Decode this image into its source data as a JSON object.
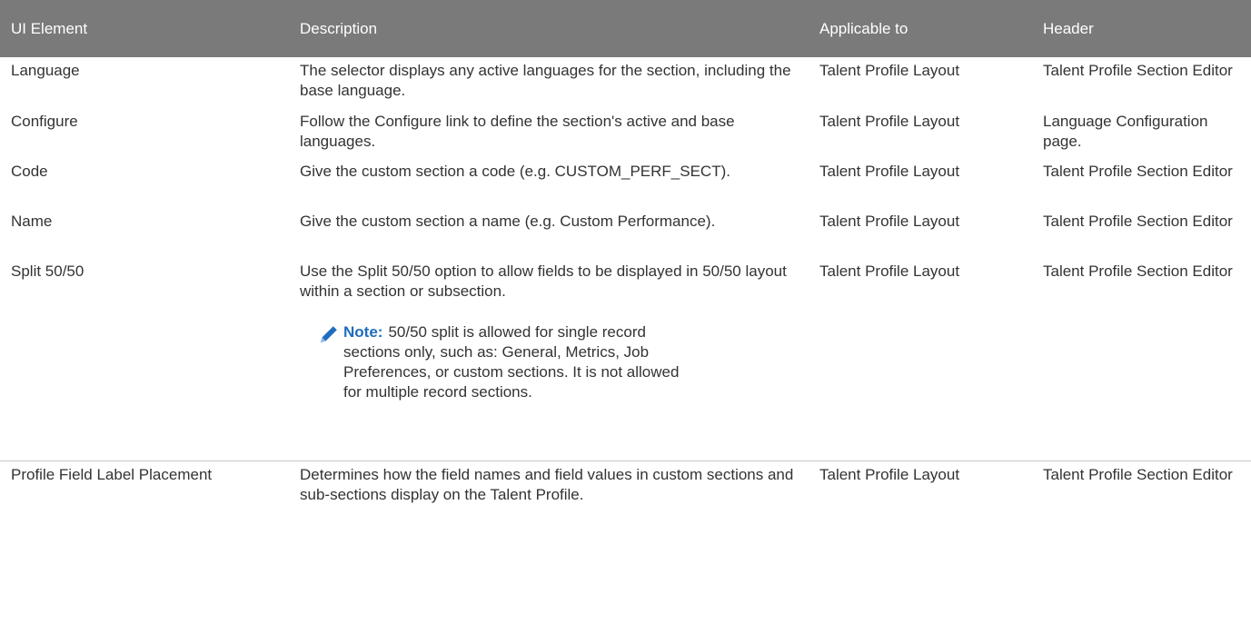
{
  "table": {
    "headers": [
      "UI Element",
      "Description",
      "Applicable to",
      "Header"
    ],
    "rows": [
      {
        "ui_element": "Language",
        "description": "The selector displays any active languages for the section, including the base language.",
        "applicable_to": "Talent Profile Layout",
        "header": "Talent Profile Section Editor"
      },
      {
        "ui_element": "Configure",
        "description": "Follow the Configure link to define the section's active and base languages.",
        "applicable_to": "Talent Profile Layout",
        "header": "Language Configuration page."
      },
      {
        "ui_element": "Code",
        "description": "Give the custom section a code (e.g. CUSTOM_PERF_SECT).",
        "applicable_to": "Talent Profile Layout",
        "header": "Talent Profile Section Editor"
      },
      {
        "ui_element": "Name",
        "description": "Give the custom section a name (e.g. Custom Performance).",
        "applicable_to": "Talent Profile Layout",
        "header": "Talent Profile Section Editor"
      },
      {
        "ui_element": "Split 50/50",
        "description": "Use the Split 50/50 option to allow fields to be displayed in 50/50 layout within a section or subsection.",
        "note_label": "Note:",
        "note_text": "50/50 split is allowed for single record sections only, such as: General, Metrics, Job Preferences, or custom sections. It is not allowed for multiple record sections.",
        "applicable_to": "Talent Profile Layout",
        "header": "Talent Profile Section Editor"
      },
      {
        "ui_element": "Profile Field Label Placement",
        "description": "Determines how the field names and field values in custom sections and sub-sections display on the Talent Profile.",
        "applicable_to": "Talent Profile Layout",
        "header": "Talent Profile Section Editor"
      }
    ]
  },
  "note_icon": "pencil-icon",
  "colors": {
    "header_bg": "#7a7a7a",
    "header_text": "#ffffff",
    "body_text": "#333333",
    "note_label": "#1f6dbf",
    "divider": "#c8c8c8"
  }
}
